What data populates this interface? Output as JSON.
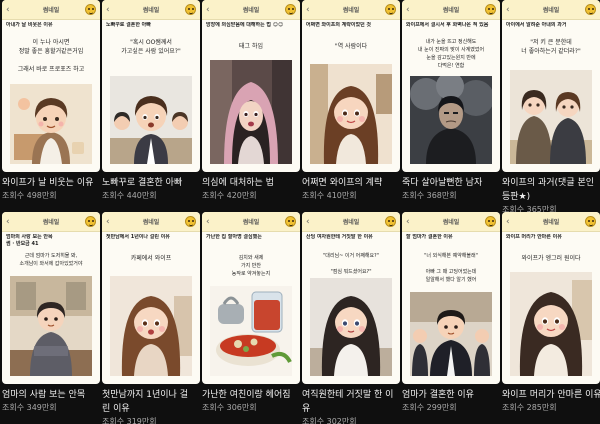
{
  "cards": [
    {
      "badge": "썸네일",
      "caption": "아내가 날 비웃은 이유",
      "bubble": "이 누나 아시면\n정말 좋은 흥할거같은거임\n\n그래서 바로 프로포즈 하고",
      "title": "와이프가 날 비웃는 이유",
      "views": "조회수 498만회",
      "theme": "cafe"
    },
    {
      "badge": "썸네일",
      "caption": "노빠꾸로 결혼한 아빠",
      "bubble": "\"혹시 OO쌤께서\n가고싶은 사람 있어요?\"",
      "title": "노빠꾸로 결혼한 아빠",
      "views": "조회수 440만회",
      "theme": "office"
    },
    {
      "badge": "썸네일",
      "caption": "방장에 의심받음에 대해하는 법 ☺☺",
      "bubble": "태그 하임",
      "title": "의심에 대처하는 법",
      "views": "조회수 420만회",
      "theme": "hood"
    },
    {
      "badge": "썸네일",
      "caption": "어쩌면 와이프의 계략이었던 것",
      "bubble": "\"역 사람이다",
      "title": "어쩌면 와이프의 계략",
      "views": "조회수 410만회",
      "theme": "girl"
    },
    {
      "badge": "썸네일",
      "caption": "와이프에서 결시서 후 화벽나온 적 있음",
      "bubble": "내가 눈을 뜨고 정신해도\n내 눈이 진짜의 맞이 사계였었어\n눈을 감고있는원지 반에\n다먹은! 연함",
      "title": "죽다 살아날뻔한 남자",
      "views": "조회수 368만회",
      "theme": "dark"
    },
    {
      "badge": "썸네일",
      "caption": "아이에서 알려준 아내의 과거",
      "bubble": "\"저 키 큰 분한데\n너 좋아하는거 같더라?\"",
      "title": "와이프의 과거(댓글 본인\n등판★)",
      "views": "조회수 365만회",
      "theme": "couple"
    },
    {
      "badge": "썸네일",
      "caption": "엄마의 사랑 보는 안목\n썸 · 반모금 41",
      "bubble": "근데 엄마가 도저히물 봐,\n소개남이 와서에 갑아있었거야",
      "title": "엄마의 사람 보는 안목",
      "views": "조회수 349만회",
      "theme": "cafe2"
    },
    {
      "badge": "썸네일",
      "caption": "첫만남에서 1년이나 걸린 이유",
      "bubble": "카페에서 와이프",
      "title": "첫만남까지 1년이나 걸\n린 이유",
      "views": "조회수 319만회",
      "theme": "girl2"
    },
    {
      "badge": "썸네일",
      "caption": "가난한 집 할아명 결심했는",
      "bubble": "김치와 새제\n가지 반찬\n농작로 약겨놓는지",
      "title": "가난한 여친이랑 헤어짐",
      "views": "조회수 306만회",
      "theme": "food"
    },
    {
      "badge": "썸네일",
      "caption": "산딩 여자원한테 거짓말 한 이유",
      "bubble": "\"대리님~ 이거 어째해요?\"\n\n\"점심 뭐드셨어요?\"",
      "title": "여직원한테 거짓말 한 이\n유",
      "views": "조회수 302만회",
      "theme": "girl3"
    },
    {
      "badge": "썸네일",
      "caption": "할 엄마가 결혼한 이유",
      "bubble": "\"너 외식해본 예약해볼래\"\n\n아빠 그 때 고딩어었는데\n일알해서 했다 알기 했어",
      "title": "엄마가 결혼한 이유",
      "views": "조회수 299만회",
      "theme": "school"
    },
    {
      "badge": "썸네일",
      "caption": "와이프 머리가 안마른 이유",
      "bubble": "와이프가 엥그러 원이다",
      "title": "와이프 머리가 안마른 이유",
      "views": "조회수 285만회",
      "theme": "girl4"
    }
  ]
}
